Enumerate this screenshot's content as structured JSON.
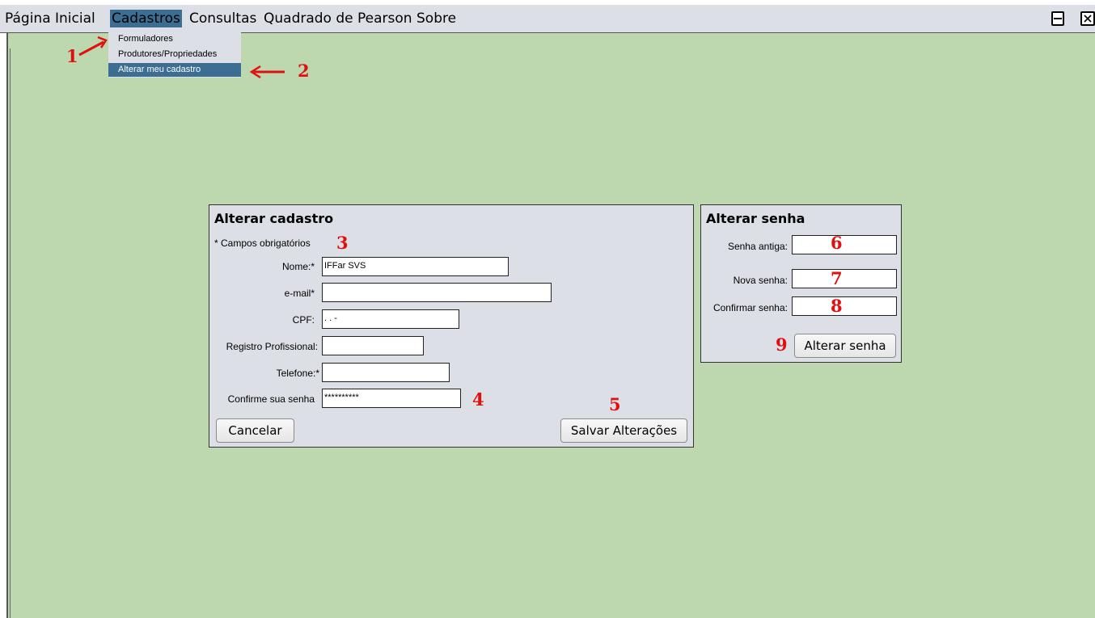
{
  "menubar": {
    "items": [
      "Página Inicial",
      "Cadastros",
      "Consultas",
      "Quadrado de Pearson",
      "Sobre"
    ],
    "active_index": 1
  },
  "dropdown": {
    "items": [
      "Formuladores",
      "Produtores/Propriedades",
      "Alterar meu cadastro"
    ],
    "selected_index": 2
  },
  "annotations": [
    "1",
    "2",
    "3",
    "4",
    "5",
    "6",
    "7",
    "8",
    "9"
  ],
  "cadastro": {
    "title": "Alterar cadastro",
    "required_note": "* Campos obrigatórios",
    "nome_label": "Nome:*",
    "nome_value": "IFFar SVS",
    "email_label": "e-mail*",
    "email_value": "",
    "cpf_label": "CPF:",
    "cpf_value": " .  .  -",
    "registro_label": "Registro Profissional:",
    "registro_value": "",
    "telefone_label": "Telefone:*",
    "telefone_value": "",
    "confirme_label": "Confirme sua senha",
    "confirme_value": "**********",
    "cancel_label": "Cancelar",
    "save_label": "Salvar Alterações"
  },
  "senha": {
    "title": "Alterar senha",
    "antiga_label": "Senha antiga:",
    "nova_label": "Nova senha:",
    "confirmar_label": "Confirmar senha:",
    "button_label": "Alterar senha"
  },
  "colors": {
    "desktop": "#bdd8ae",
    "panel": "#dddfe6",
    "menu_highlight": "#3c6d93",
    "annotation": "#e01010"
  }
}
